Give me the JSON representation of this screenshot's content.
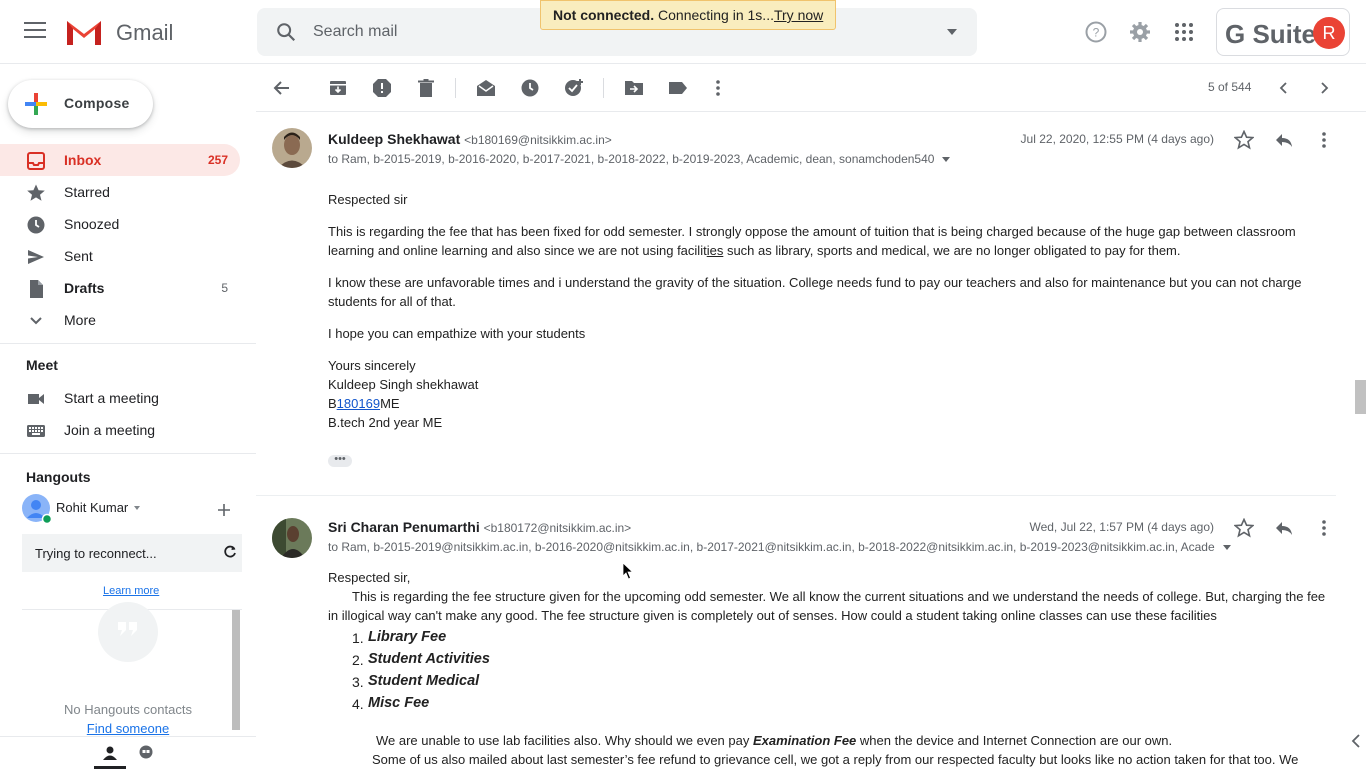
{
  "header": {
    "app_name": "Gmail",
    "search_placeholder": "Search mail",
    "toast_bold": "Not connected.",
    "toast_text": " Connecting in 1s...",
    "toast_link": "Try now",
    "brand": "G Suite",
    "avatar_letter": "R"
  },
  "compose": {
    "label": "Compose"
  },
  "nav": [
    {
      "label": "Inbox",
      "count": "257",
      "icon": "inbox-icon"
    },
    {
      "label": "Starred",
      "count": "",
      "icon": "star-icon"
    },
    {
      "label": "Snoozed",
      "count": "",
      "icon": "clock-icon"
    },
    {
      "label": "Sent",
      "count": "",
      "icon": "send-icon"
    },
    {
      "label": "Drafts",
      "count": "5",
      "icon": "draft-icon"
    },
    {
      "label": "More",
      "count": "",
      "icon": "chevron-down-icon"
    }
  ],
  "meet": {
    "title": "Meet",
    "start": "Start a meeting",
    "join": "Join a meeting"
  },
  "hangouts": {
    "title": "Hangouts",
    "user": "Rohit Kumar",
    "status": "Trying to reconnect...",
    "learn_more": "Learn more",
    "no_contacts": "No Hangouts contacts",
    "find_someone": "Find someone"
  },
  "toolbar": {
    "pager": "5 of 544"
  },
  "messages": [
    {
      "sender": "Kuldeep Shekhawat",
      "email": "<b180169@nitsikkim.ac.in>",
      "recipients": "to Ram, b-2015-2019, b-2016-2020, b-2017-2021, b-2018-2022, b-2019-2023, Academic, dean, sonamchoden540",
      "date": "Jul 22, 2020, 12:55 PM (4 days ago)",
      "p1": "Respected sir",
      "p2a": "This is regarding the fee that has been fixed for odd semester. I strongly oppose the amount of tuition that is being charged because of the huge gap between classroom",
      "p2b_pre": "learning and online learning and also since we are not using facilit",
      "p2b_link": "ies",
      "p2b_post": " such as library, sports and medical, we are no longer obligated to pay for them.",
      "p3a": "I know these are unfavorable times and i understand the gravity of the situation. College needs fund to pay our teachers and also for maintenance but you can not charge",
      "p3b": "students for all of that.",
      "p4": "I hope you can empathize with your students",
      "sig1": "Yours sincerely",
      "sig2": "Kuldeep Singh shekhawat",
      "sig3_pre": "B",
      "sig3_link": "180169",
      "sig3_post": "ME",
      "sig4": "B.tech 2nd year ME"
    },
    {
      "sender": "Sri Charan Penumarthi",
      "email": "<b180172@nitsikkim.ac.in>",
      "recipients": "to Ram, b-2015-2019@nitsikkim.ac.in, b-2016-2020@nitsikkim.ac.in, b-2017-2021@nitsikkim.ac.in, b-2018-2022@nitsikkim.ac.in, b-2019-2023@nitsikkim.ac.in, Acade",
      "date": "Wed, Jul 22, 1:57 PM (4 days ago)",
      "p1": "Respected sir,",
      "p2a": "This is regarding the fee structure given for the upcoming odd semester. We all know the current situations and we understand the needs of college. But, charging the fee",
      "p2b": "in illogical way can't make any good. The fee structure given is completely out of senses. How could a student taking online classes can use these facilities",
      "list": [
        "Library Fee",
        "Student Activities",
        "Student Medical",
        "Misc Fee"
      ],
      "list_nums": [
        "1.",
        "2.",
        "3.",
        "4."
      ],
      "p3_pre": "We are unable to use lab facilities also. Why should we even pay ",
      "p3_bold": "Examination Fee",
      "p3_post": " when the device and Internet Connection are our own.",
      "p4": "Some of us also mailed about last semester’s fee refund to grievance cell, we got a reply from our respected faculty but looks like no action taken for that too. We"
    }
  ]
}
